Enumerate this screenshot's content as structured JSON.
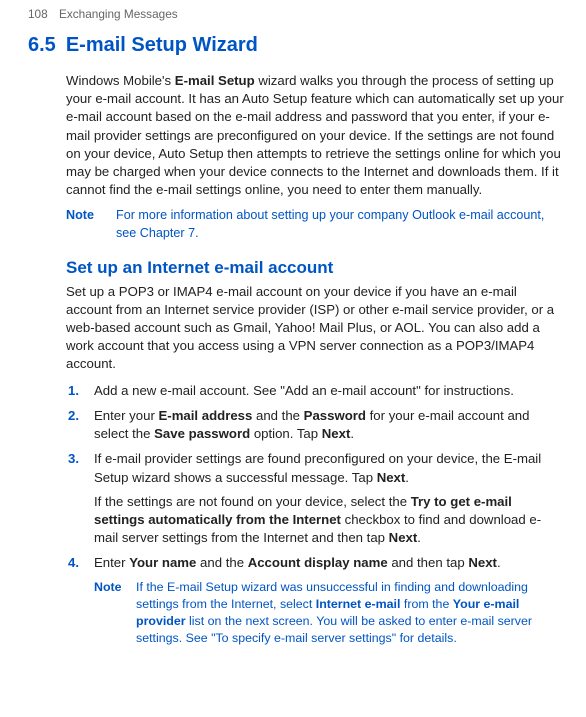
{
  "header": {
    "page_number": "108",
    "chapter_title": "Exchanging Messages"
  },
  "section": {
    "number": "6.5",
    "title": "E-mail Setup Wizard"
  },
  "intro_parts": {
    "a": "Windows Mobile's ",
    "b": "E-mail Setup",
    "c": " wizard walks you through the process of setting up your e-mail account. It has an Auto Setup feature which can automatically set up your e-mail account based on the e-mail address and password that you enter, if your e-mail provider settings are preconfigured on your device. If the settings are not found on your device, Auto Setup then attempts to retrieve the settings online for which you may be charged when your device connects to the Internet and downloads them. If it cannot find the e-mail settings online, you need to enter them manually."
  },
  "note1": {
    "label": "Note",
    "text": "For more information about setting up your company Outlook e-mail account, see Chapter 7."
  },
  "subheading": "Set up an Internet e-mail account",
  "sub_intro": "Set up a POP3 or IMAP4 e-mail account on your device if you have an e-mail account from an Internet service provider (ISP) or other e-mail service provider, or a web-based account such as Gmail, Yahoo! Mail Plus, or AOL. You can also add a work account that you access using a VPN server connection as a POP3/IMAP4 account.",
  "steps": {
    "s1": "Add a new e-mail account. See \"Add an e-mail account\" for instructions.",
    "s2": {
      "a": "Enter your ",
      "b": "E-mail address",
      "c": " and the ",
      "d": "Password",
      "e": " for your e-mail account and select the ",
      "f": "Save password",
      "g": " option. Tap ",
      "h": "Next",
      "i": "."
    },
    "s3": {
      "p1a": "If e-mail provider settings are found preconfigured on your device, the E-mail Setup wizard shows a successful message. Tap ",
      "p1b": "Next",
      "p1c": ".",
      "p2a": "If the settings are not found on your device, select the ",
      "p2b": "Try to get e-mail settings automatically from the Internet",
      "p2c": " checkbox to find and download e-mail server settings from the Internet and then tap ",
      "p2d": "Next",
      "p2e": "."
    },
    "s4": {
      "a": "Enter ",
      "b": "Your name",
      "c": " and the ",
      "d": "Account display name",
      "e": " and then tap ",
      "f": "Next",
      "g": "."
    }
  },
  "note2": {
    "label": "Note",
    "a": "If the E-mail Setup wizard was unsuccessful in finding and downloading settings from the Internet, select ",
    "b": "Internet e-mail",
    "c": " from the ",
    "d": "Your e-mail provider",
    "e": " list on the next screen. You will be asked to enter e-mail server settings. See \"To specify e-mail server settings\" for details."
  }
}
